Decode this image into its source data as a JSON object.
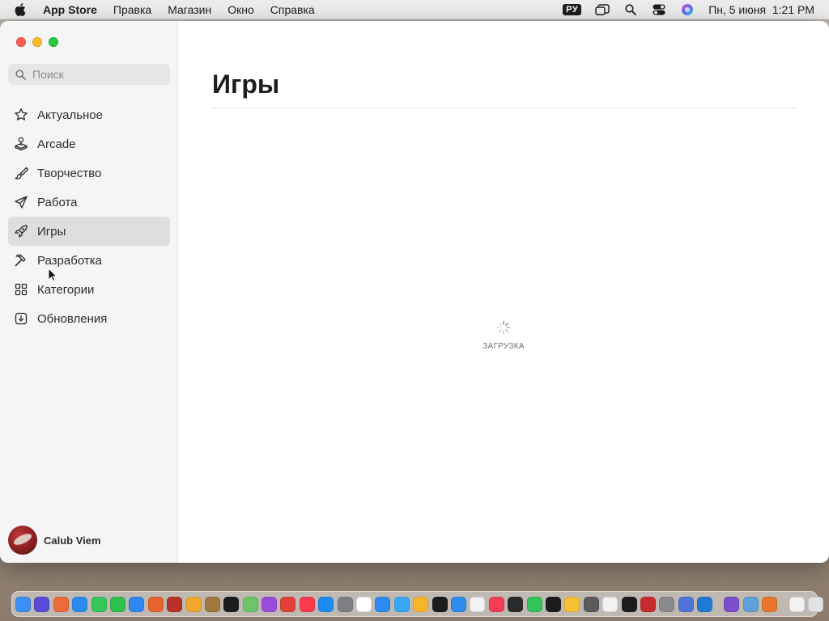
{
  "menubar": {
    "app_name": "App Store",
    "menus": [
      "Правка",
      "Магазин",
      "Окно",
      "Справка"
    ],
    "input_source": "РУ",
    "datetime": "Пн, 5 июня  1:21 PM"
  },
  "sidebar": {
    "search_placeholder": "Поиск",
    "items": [
      {
        "label": "Актуальное",
        "icon": "star-icon"
      },
      {
        "label": "Arcade",
        "icon": "joystick-icon"
      },
      {
        "label": "Творчество",
        "icon": "brush-icon"
      },
      {
        "label": "Работа",
        "icon": "paper-plane-icon"
      },
      {
        "label": "Игры",
        "icon": "rocket-icon",
        "active": true
      },
      {
        "label": "Разработка",
        "icon": "hammer-icon"
      },
      {
        "label": "Категории",
        "icon": "grid-icon"
      },
      {
        "label": "Обновления",
        "icon": "download-icon"
      }
    ],
    "user_name": "Calub Viem"
  },
  "main": {
    "title": "Игры",
    "loading_text": "ЗАГРУЗКА"
  },
  "dock": {
    "apps": [
      {
        "name": "finder-icon",
        "color": "#3b8ff5"
      },
      {
        "name": "siri-icon",
        "color": "#5a4bd6"
      },
      {
        "name": "launchpad-icon",
        "color": "#e96c3a"
      },
      {
        "name": "safari-icon",
        "color": "#2b8cf0"
      },
      {
        "name": "messages-icon",
        "color": "#34c759"
      },
      {
        "name": "facetime-icon",
        "color": "#2fbf4f"
      },
      {
        "name": "mail-icon",
        "color": "#2f87f3"
      },
      {
        "name": "firefox-icon",
        "color": "#e8632b"
      },
      {
        "name": "dictionary-icon",
        "color": "#b8322a"
      },
      {
        "name": "notes-folder-icon",
        "color": "#f0a82b"
      },
      {
        "name": "notebook-icon",
        "color": "#a0773f"
      },
      {
        "name": "appletv-icon",
        "color": "#1c1c1e"
      },
      {
        "name": "maps-icon",
        "color": "#6fc36a"
      },
      {
        "name": "podcasts-icon",
        "color": "#9a4bdb"
      },
      {
        "name": "chrome-icon",
        "color": "#e3403a"
      },
      {
        "name": "music-icon",
        "color": "#fa3b4f"
      },
      {
        "name": "appstore-icon",
        "color": "#1d8cf0"
      },
      {
        "name": "settings-icon",
        "color": "#7e7e84"
      },
      {
        "name": "calendar-icon",
        "color": "#ffffff"
      },
      {
        "name": "files-icon",
        "color": "#2c8cf3"
      },
      {
        "name": "freeform-icon",
        "color": "#3aa7f5"
      },
      {
        "name": "photos-icon",
        "color": "#f5b52c"
      },
      {
        "name": "stocks-icon",
        "color": "#1c1c1e"
      },
      {
        "name": "keynote-icon",
        "color": "#2f8cf0"
      },
      {
        "name": "reminders-icon",
        "color": "#f2f2f2"
      },
      {
        "name": "news-icon",
        "color": "#f23d52"
      },
      {
        "name": "activity-monitor-icon",
        "color": "#2b2b2b"
      },
      {
        "name": "find-my-icon",
        "color": "#33c25b"
      },
      {
        "name": "clock-icon",
        "color": "#1c1c1e"
      },
      {
        "name": "home-icon",
        "color": "#f6c035"
      },
      {
        "name": "calculator-icon",
        "color": "#5a5a5e"
      },
      {
        "name": "textedit-icon",
        "color": "#f2f2f2"
      },
      {
        "name": "terminal-icon",
        "color": "#1c1c1e"
      },
      {
        "name": "photo-booth-icon",
        "color": "#c72a2a"
      },
      {
        "name": "script-editor-icon",
        "color": "#8a8a8e"
      },
      {
        "name": "xcode-icon",
        "color": "#4f74d8"
      },
      {
        "name": "vscode-icon",
        "color": "#1f7ad3"
      }
    ],
    "recent_apps": [
      {
        "name": "visual-studio-icon",
        "color": "#7a4fc9"
      },
      {
        "name": "preview-icon",
        "color": "#5fa0d8"
      },
      {
        "name": "blender-icon",
        "color": "#e8772d"
      }
    ],
    "trailing": [
      {
        "name": "downloads-stack-icon",
        "color": "#f2f2f2"
      },
      {
        "name": "trash-icon",
        "color": "#e3e3e3"
      }
    ]
  }
}
